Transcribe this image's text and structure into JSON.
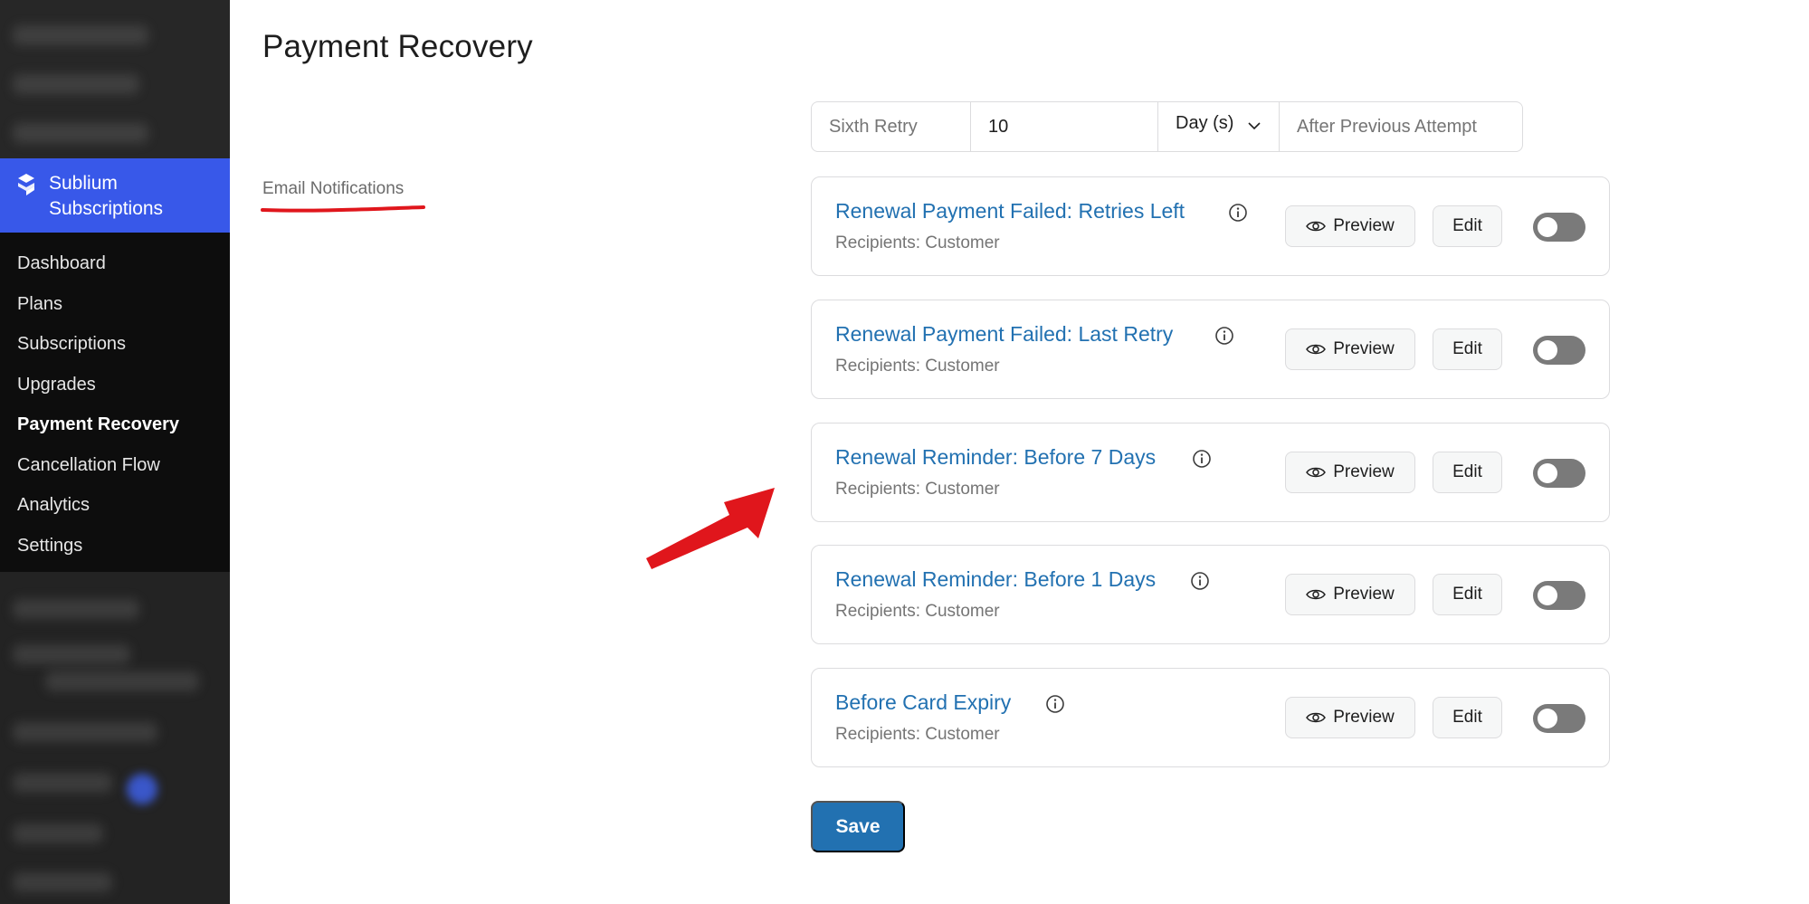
{
  "sidebar": {
    "brand_line1": "Sublium",
    "brand_line2": "Subscriptions",
    "items": [
      {
        "label": "Dashboard"
      },
      {
        "label": "Plans"
      },
      {
        "label": "Subscriptions"
      },
      {
        "label": "Upgrades"
      },
      {
        "label": "Payment Recovery",
        "active": true
      },
      {
        "label": "Cancellation Flow"
      },
      {
        "label": "Analytics"
      },
      {
        "label": "Settings"
      }
    ]
  },
  "page": {
    "title": "Payment Recovery",
    "section_label": "Email Notifications"
  },
  "retry": {
    "label": "Sixth Retry",
    "value": "10",
    "unit": "Day (s)",
    "after": "After Previous Attempt"
  },
  "notifications": [
    {
      "title": "Renewal Payment Failed: Retries Left",
      "recipients": "Recipients: Customer",
      "enabled": false
    },
    {
      "title": "Renewal Payment Failed: Last Retry",
      "recipients": "Recipients: Customer",
      "enabled": false
    },
    {
      "title": "Renewal Reminder: Before 7 Days",
      "recipients": "Recipients: Customer",
      "enabled": false
    },
    {
      "title": "Renewal Reminder: Before 1 Days",
      "recipients": "Recipients: Customer",
      "enabled": false
    },
    {
      "title": "Before Card Expiry",
      "recipients": "Recipients: Customer",
      "enabled": false
    }
  ],
  "buttons": {
    "preview": "Preview",
    "edit": "Edit",
    "save": "Save"
  },
  "colors": {
    "sidebar_bg": "#0d0d0d",
    "brand_bg": "#3858e9",
    "link": "#2271b1",
    "primary": "#2271b1",
    "annotation": "#e0161c"
  },
  "icons": {
    "brand": "sublium-logo-icon",
    "info": "info-icon",
    "preview": "eye-icon",
    "select": "chevron-down-icon",
    "annotation_arrow": "red-arrow",
    "annotation_underline": "red-underline"
  }
}
